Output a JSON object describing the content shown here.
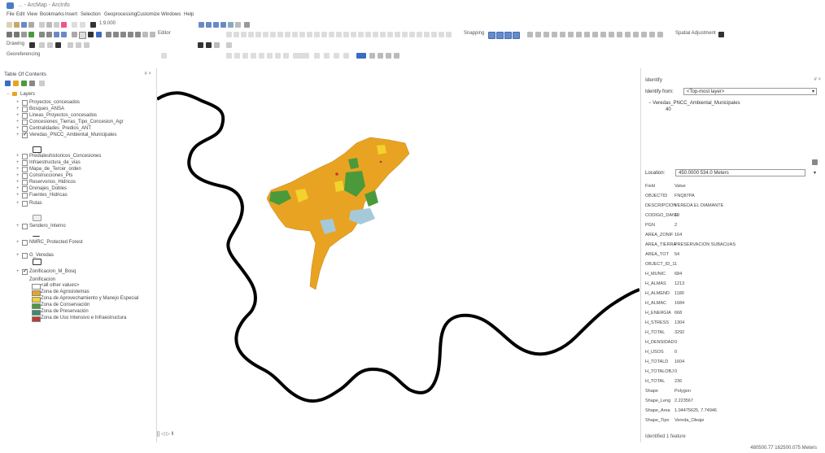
{
  "window": {
    "title": "... - ArcMap - ArcInfo"
  },
  "menu": [
    "File",
    "Edit",
    "View",
    "Bookmarks",
    "Insert",
    "Selection",
    "Geoprocessing",
    "Customize",
    "Windows",
    "Help"
  ],
  "toolbar": {
    "scale": "1:9.000",
    "drawing_label": "Drawing",
    "georeferencing_label": "Georeferencing",
    "editor_label": "Editor",
    "snapping_label": "Snapping",
    "spatial_adjustment_label": "Spatial Adjustment"
  },
  "toc": {
    "title": "Table Of Contents",
    "pin": "# ×",
    "layers_root": "Layers",
    "layers": [
      {
        "label": "Proyectos_concesados",
        "checked": false
      },
      {
        "label": "Bosques_ANSA",
        "checked": false
      },
      {
        "label": "Lineas_Proyectos_concesados",
        "checked": false
      },
      {
        "label": "Concesiones_Tierras_Tipo_Concesion_Agr",
        "checked": false
      },
      {
        "label": "Centralidades_Predios_ANT",
        "checked": false
      },
      {
        "label": "Veredas_PNCC_Ambiental_Municipales",
        "checked": true
      },
      {
        "label": "Predialeshistoricos_Concesiones",
        "checked": false
      },
      {
        "label": "Infraestructura_de_vias",
        "checked": false
      },
      {
        "label": "Mapa_de_Tercer_orden",
        "checked": false
      },
      {
        "label": "Construcciones_Pts",
        "checked": false
      },
      {
        "label": "Reservorios_Hidricos",
        "checked": false
      },
      {
        "label": "Drenajes_Dobles",
        "checked": false
      },
      {
        "label": "Fuentes_Hidricas",
        "checked": false
      },
      {
        "label": "Rutas",
        "checked": false
      },
      {
        "label": "Sendero_Interno",
        "checked": false
      },
      {
        "label": "NMRC_Protected Forest",
        "checked": false
      },
      {
        "label": "G_Veredas",
        "checked": false
      },
      {
        "label": "Zonificacion_M_Bosq",
        "checked": true
      }
    ],
    "zonificacion_field": "Zonificacion",
    "legend": [
      {
        "label": "<all other values>",
        "color": "#ffffff"
      },
      {
        "label": "Zona de Agrosistemas",
        "color": "#e9a322"
      },
      {
        "label": "Zona de Aprovechamiento y Manejo Especial",
        "color": "#f3d22e"
      },
      {
        "label": "Zona de Conservación",
        "color": "#4a9a3c"
      },
      {
        "label": "Zona de Preservación",
        "color": "#3d8a6f"
      },
      {
        "label": "Zona de Uso Intensivo e Infraestructura",
        "color": "#c0392b"
      }
    ]
  },
  "map": {
    "status": "[] ◁ ▷ Ⅱ"
  },
  "identify": {
    "title": "Identify",
    "pin": "# ×",
    "identify_from_label": "Identify from:",
    "identify_from_value": "<Top-most layer>",
    "tree_item": "Veredas_PNCC_Ambiental_Municipales",
    "tree_sub": "40",
    "location_label": "Location:",
    "location_value": "450.0000 534.0 Meters",
    "fields": [
      {
        "k": "Field",
        "v": "Value"
      },
      {
        "k": "OBJECTID",
        "v": "FNQ87PA"
      },
      {
        "k": "DESCRIPCION",
        "v": "VEREDA EL DIAMANTE"
      },
      {
        "k": "CODIGO_DANE",
        "v": "18"
      },
      {
        "k": "PGN",
        "v": "2"
      },
      {
        "k": "AREA_ZONIF",
        "v": "164"
      },
      {
        "k": "AREA_TIERRA",
        "v": "PRESERVACION SUBACUAS"
      },
      {
        "k": "AREA_TOT",
        "v": "54"
      },
      {
        "k": "OBJECT_ID_1",
        "v": "1"
      },
      {
        "k": "H_MUNIC",
        "v": "684"
      },
      {
        "k": "H_ALMAS",
        "v": "1213"
      },
      {
        "k": "H_ALMEND",
        "v": "1180"
      },
      {
        "k": "H_ALMAC",
        "v": "1684"
      },
      {
        "k": "H_ENERGIA",
        "v": "668"
      },
      {
        "k": "H_STRESS",
        "v": "1304"
      },
      {
        "k": "H_TOTAL",
        "v": "3292"
      },
      {
        "k": "H_DENSIDAD",
        "v": "0"
      },
      {
        "k": "H_USOS",
        "v": "0"
      },
      {
        "k": "H_TOTALD",
        "v": "1604"
      },
      {
        "k": "H_TOTALOBJ",
        "v": "0"
      },
      {
        "k": "H_TOTAL",
        "v": "236"
      },
      {
        "k": "Shape",
        "v": "Polygon"
      },
      {
        "k": "Shape_Leng",
        "v": "2.223567"
      },
      {
        "k": "Shape_Area",
        "v": "1.04475625, 7.74946"
      },
      {
        "k": "Shape_Tipo",
        "v": "Vereda_Oleaje"
      }
    ],
    "footer": "Identified 1 feature"
  },
  "status": {
    "coords": "480500.77  162500.075 Meters"
  }
}
